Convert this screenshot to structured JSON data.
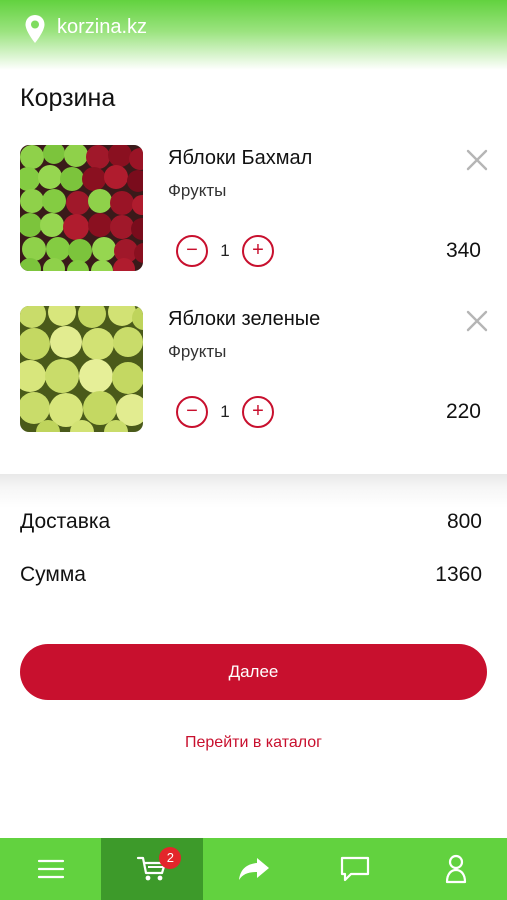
{
  "header": {
    "site": "korzina.kz",
    "icon": "location-pin-icon"
  },
  "cart": {
    "title": "Корзина",
    "items": [
      {
        "name": "Яблоки Бахмал",
        "category": "Фрукты",
        "quantity": "1",
        "price": "340",
        "image": "red-green-apples"
      },
      {
        "name": "Яблоки зеленые",
        "category": "Фрукты",
        "quantity": "1",
        "price": "220",
        "image": "green-apples"
      }
    ],
    "minus_symbol": "−",
    "plus_symbol": "+"
  },
  "summary": {
    "delivery_label": "Доставка",
    "delivery_value": "800",
    "total_label": "Сумма",
    "total_value": "1360"
  },
  "actions": {
    "next_label": "Далее",
    "catalog_link": "Перейти в каталог"
  },
  "bottom_nav": {
    "items": [
      "menu-icon",
      "cart-icon",
      "share-arrow-icon",
      "chat-icon",
      "profile-icon"
    ],
    "active": "cart-icon",
    "cart_badge": "2"
  },
  "colors": {
    "accent": "#c8102e",
    "nav_green": "#62d23f",
    "nav_active": "#3d9a2a"
  }
}
